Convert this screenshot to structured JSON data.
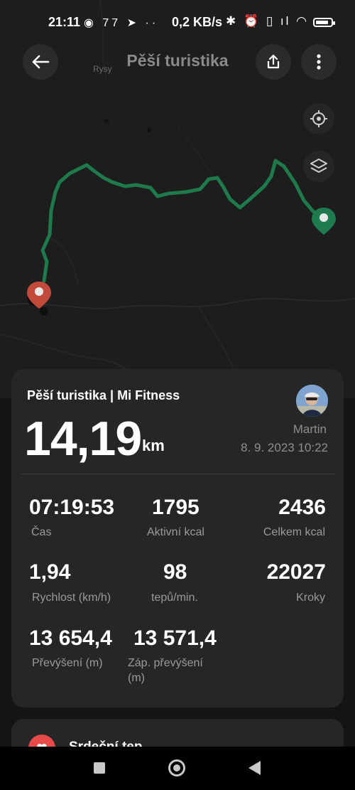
{
  "status_bar": {
    "time": "21:11",
    "notification_icons": "◉ 77 ➤ ··",
    "net_speed": "0,2 KB/s",
    "right_icons": "✱ ⏰ ▯ ıl ◠"
  },
  "header": {
    "title": "Pěší turistika",
    "back_icon": "arrow-left-icon",
    "share_icon": "share-icon",
    "more_icon": "more-vertical-icon"
  },
  "map": {
    "place_label": "Rysy",
    "colors": {
      "route": "#1e7a4a",
      "start_pin": "#c24a3a",
      "end_pin": "#1f7a4d"
    }
  },
  "summary": {
    "title": "Pěší turistika | Mi Fitness",
    "distance": "14,19",
    "distance_unit": "km",
    "user": "Martin",
    "datetime": "8. 9. 2023 10:22",
    "stats": [
      {
        "value": "07:19:53",
        "label": "Čas"
      },
      {
        "value": "1795",
        "label": "Aktivní kcal"
      },
      {
        "value": "2436",
        "label": "Celkem kcal"
      },
      {
        "value": "1,94",
        "label": "Rychlost (km/h)"
      },
      {
        "value": "98",
        "label": "tepů/min."
      },
      {
        "value": "22027",
        "label": "Kroky"
      },
      {
        "value": "13 654,4",
        "label": "Převýšení (m)"
      },
      {
        "value": "13 571,4",
        "label": "Záp. převýšení (m)"
      }
    ]
  },
  "next_card": {
    "title": "Srdeční tep"
  },
  "colors": {
    "background": "#141414",
    "card": "#262626",
    "muted_text": "#9a9a9a"
  }
}
